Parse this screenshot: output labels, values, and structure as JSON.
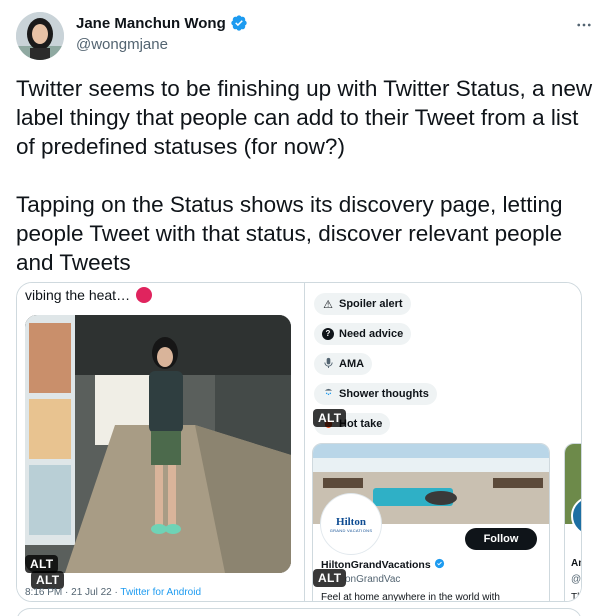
{
  "tweet": {
    "display_name": "Jane Manchun Wong",
    "handle": "@wongmjane",
    "text": "Twitter seems to be finishing up with Twitter Status, a new label thingy that people can add to their Tweet from a list of predefined statuses (for now?)\n\nTapping on the Status shows its discovery page, letting people Tweet with that status, discover relevant people and Tweets",
    "more_icon": "ellipsis-icon",
    "verified_icon": "verified-badge-icon",
    "accent_color": "#1d9bf0"
  },
  "media_left": {
    "caption": "vibing the heat…",
    "alt_top": "ALT",
    "alt_label": "ALT",
    "time": "8:16 PM · 21 Jul 22 · ",
    "source": "Twitter for Android"
  },
  "media_right": {
    "alt_top": "ALT",
    "alt_bottom": "ALT",
    "statuses": [
      {
        "emoji": "⚠️",
        "label": "Spoiler alert",
        "icon": "warning-icon"
      },
      {
        "emoji": "?",
        "label": "Need advice",
        "icon": "question-icon"
      },
      {
        "emoji": "🎤",
        "label": "AMA",
        "icon": "microphone-icon"
      },
      {
        "emoji": "🚿",
        "label": "Shower thoughts",
        "icon": "shower-icon"
      },
      {
        "emoji": "🔥",
        "label": "Hot take",
        "icon": "fire-icon"
      }
    ],
    "card": {
      "logo": "Hilton",
      "logo_sub": "GRAND VACATIONS",
      "follow_label": "Follow",
      "name": "HiltonGrandVacations",
      "handle": "onGrandVac",
      "description": "Feel at home anywhere in the world with"
    },
    "card2": {
      "name": "Am",
      "handle": "@A",
      "description": "The"
    }
  }
}
